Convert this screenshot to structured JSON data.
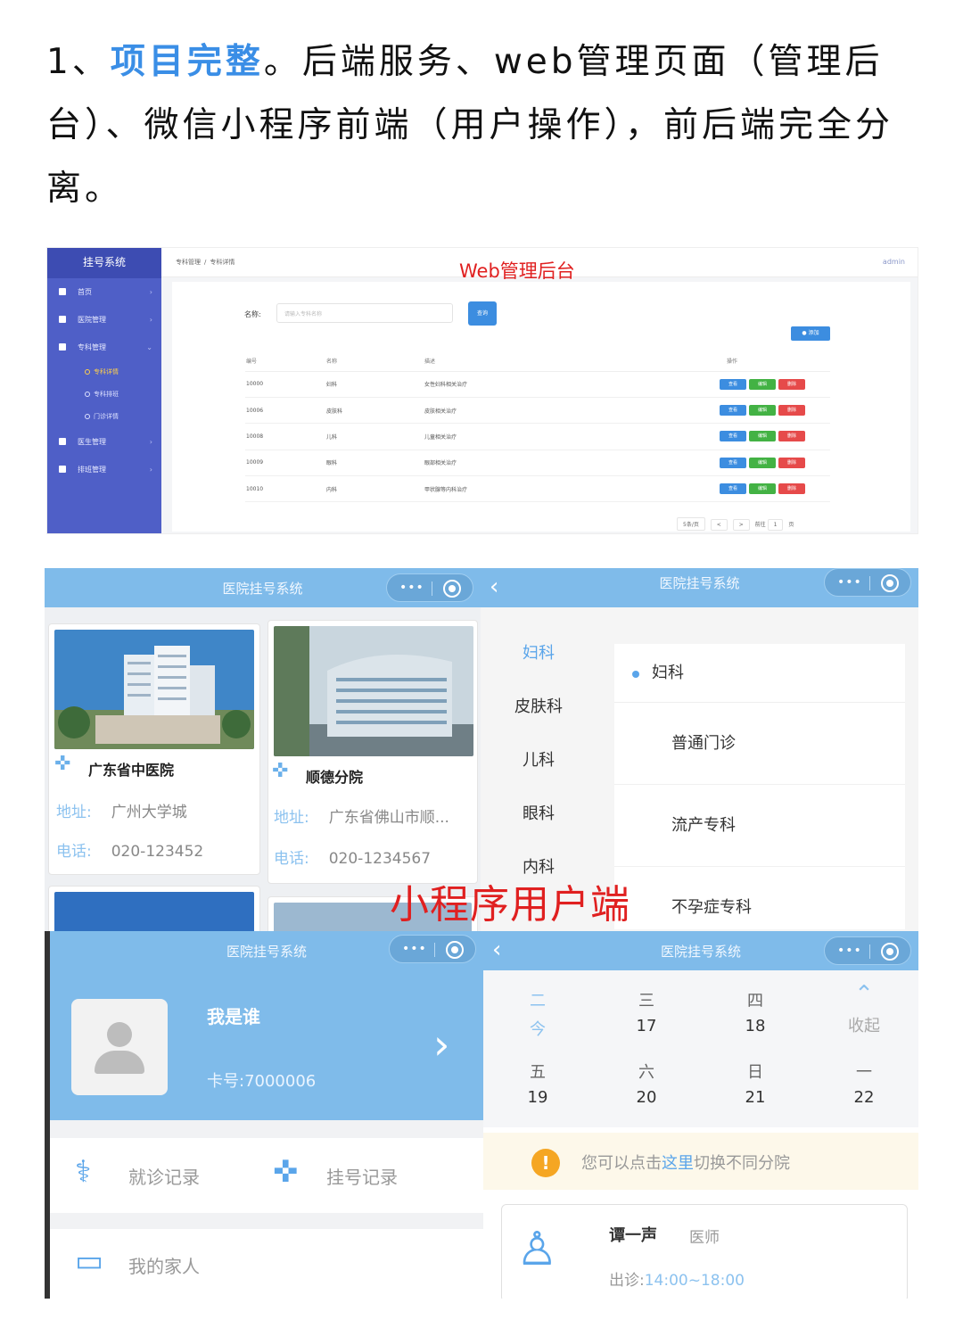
{
  "intro": {
    "prefix": "1、",
    "highlight": "项目完整",
    "rest": "。后端服务、web管理页面（管理后台）、微信小程序前端（用户操作），前后端完全分离。"
  },
  "web": {
    "overlay_title": "Web管理后台",
    "brand": "挂号系统",
    "menu": [
      {
        "label": "首页",
        "icon": "home-icon"
      },
      {
        "label": "医院管理",
        "icon": "building-icon"
      },
      {
        "label": "专科管理",
        "icon": "layers-icon"
      }
    ],
    "submenu": [
      "专科详情",
      "专科排班",
      "门诊详情"
    ],
    "menu2": [
      {
        "label": "医生管理",
        "icon": "user-icon"
      },
      {
        "label": "排班管理",
        "icon": "file-icon"
      }
    ],
    "breadcrumb": [
      "专科管理",
      "/",
      "专科详情"
    ],
    "user": "admin",
    "search_label": "名称:",
    "search_placeholder": "请输入专科名称",
    "search_button": "查询",
    "add_button": "● 添加",
    "columns": [
      "编号",
      "名称",
      "描述",
      "操作"
    ],
    "rows": [
      {
        "id": "10000",
        "name": "妇科",
        "desc": "女性妇科相关治疗"
      },
      {
        "id": "10006",
        "name": "皮肤科",
        "desc": "皮肤相关治疗"
      },
      {
        "id": "10008",
        "name": "儿科",
        "desc": "儿童相关治疗"
      },
      {
        "id": "10009",
        "name": "眼科",
        "desc": "眼部相关治疗"
      },
      {
        "id": "10010",
        "name": "内科",
        "desc": "甲状腺等内科治疗"
      }
    ],
    "op_labels": [
      "查看",
      "编辑",
      "删除"
    ],
    "pager": {
      "size": "5条/页",
      "prev": "<",
      "next": ">",
      "goto": "前往",
      "page": "1",
      "unit": "页"
    }
  },
  "mp": {
    "nav_title": "医院挂号系统",
    "capsule_dots": "•••",
    "overlay_label": "小程序用户端",
    "hospitals": [
      {
        "name": "广东省中医院",
        "addr_label": "地址:",
        "addr": "广州大学城",
        "tel_label": "电话:",
        "tel": "020-123452"
      },
      {
        "name": "顺德分院",
        "addr_label": "地址:",
        "addr": "广东省佛山市顺...",
        "tel_label": "电话:",
        "tel": "020-1234567"
      }
    ],
    "departments": [
      "妇科",
      "皮肤科",
      "儿科",
      "眼科",
      "内科"
    ],
    "dept_selected": "妇科",
    "dept_subs": [
      "普通门诊",
      "流产专科",
      "不孕症专科"
    ],
    "profile": {
      "name": "我是谁",
      "card_label": "卡号:",
      "card_no": "7000006"
    },
    "links": [
      "就诊记录",
      "挂号记录",
      "我的家人"
    ],
    "calendar": [
      {
        "w": "二",
        "d": "今"
      },
      {
        "w": "三",
        "d": "17"
      },
      {
        "w": "四",
        "d": "18"
      },
      {
        "w": "⌃",
        "d": "收起"
      },
      {
        "w": "五",
        "d": "19"
      },
      {
        "w": "六",
        "d": "20"
      },
      {
        "w": "日",
        "d": "21"
      },
      {
        "w": "一",
        "d": "22"
      }
    ],
    "notice": {
      "before": "您可以点击",
      "link": "这里",
      "after": "切换不同分院",
      "icon": "!"
    },
    "doctor": {
      "name": "谭一声",
      "title": "医师",
      "time_label": "出诊:",
      "time": "14:00~18:00"
    }
  },
  "colors": {
    "accent": "#3a8ee6",
    "nav": "#7fbbea",
    "sidebar": "#4f5fc7",
    "overlay_red": "#e02020"
  }
}
